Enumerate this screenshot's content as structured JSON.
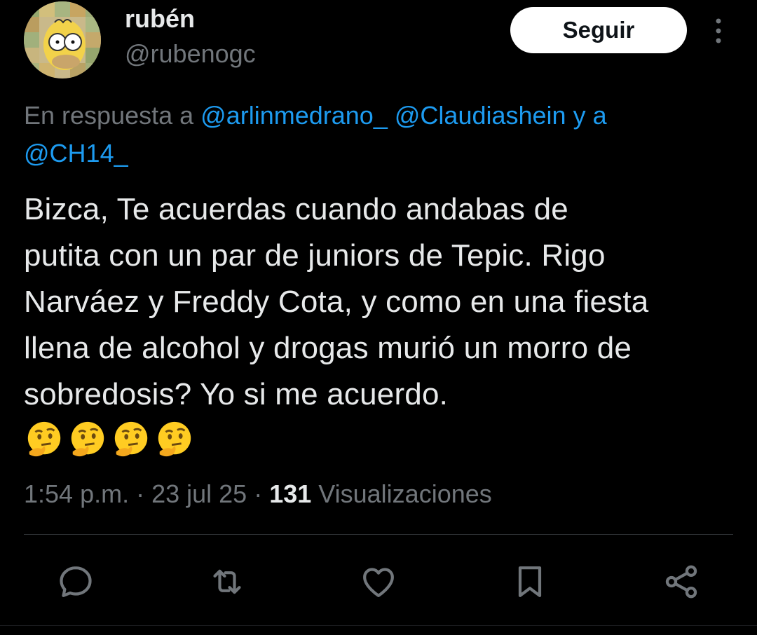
{
  "user": {
    "display_name": "rubén",
    "handle": "@rubenogc",
    "avatar_icon": "avatar-collage-icon"
  },
  "follow_button": {
    "label": "Seguir"
  },
  "more_icon": "more-vertical-icon",
  "reply_context": {
    "prefix": "En respuesta a ",
    "mention_1": "@arlinmedrano_",
    "mention_2": "@Claudiashein",
    "joiner": " y a",
    "mention_3": "@CH14_"
  },
  "tweet": {
    "line_1": "Bizca, Te acuerdas cuando andabas de",
    "line_2": "putita con un par de juniors de Tepic. Rigo",
    "line_3": "Narváez y Freddy Cota, y como en una fiesta",
    "line_4": "llena de alcohol y drogas murió un morro de",
    "line_5": "sobredosis? Yo si me acuerdo.",
    "emojis": [
      "thinking-face-icon",
      "thinking-face-icon",
      "thinking-face-icon",
      "thinking-face-icon"
    ]
  },
  "meta": {
    "time": "1:54 p.m.",
    "sep": " · ",
    "date": "23 jul 25",
    "views_count": "131",
    "views_label": " Visualizaciones"
  },
  "actions": [
    "reply-icon",
    "retweet-icon",
    "like-icon",
    "bookmark-icon",
    "share-icon"
  ],
  "colors": {
    "background": "#000000",
    "text": "#e7e9ea",
    "secondary": "#71767b",
    "link": "#1d9bf0",
    "divider": "#2f3336",
    "button_bg": "#ffffff"
  }
}
